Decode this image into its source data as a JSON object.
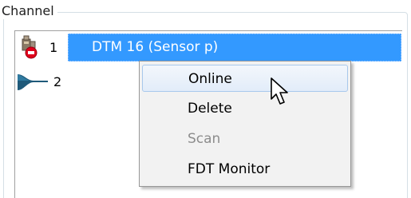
{
  "group": {
    "title": "Channel"
  },
  "tree": {
    "rows": [
      {
        "number": "1",
        "label": "DTM 16 (Sensor p)",
        "icon": "device-offline-icon",
        "selected": true
      },
      {
        "number": "2",
        "label": "",
        "icon": "channel-connector-icon",
        "selected": false
      }
    ]
  },
  "context_menu": {
    "items": [
      {
        "label": "Online",
        "enabled": true,
        "highlighted": true
      },
      {
        "label": "Delete",
        "enabled": true,
        "highlighted": false
      },
      {
        "label": "Scan",
        "enabled": false,
        "highlighted": false
      },
      {
        "label": "FDT Monitor",
        "enabled": true,
        "highlighted": false
      }
    ]
  },
  "colors": {
    "selection": "#3399ff",
    "menu_background": "#f2f2f2",
    "menu_highlight_border": "#a8c8ec",
    "disabled_text": "#8d8d8d",
    "error_red": "#e0001b"
  },
  "cursor": {
    "icon": "arrow-pointer-icon"
  }
}
